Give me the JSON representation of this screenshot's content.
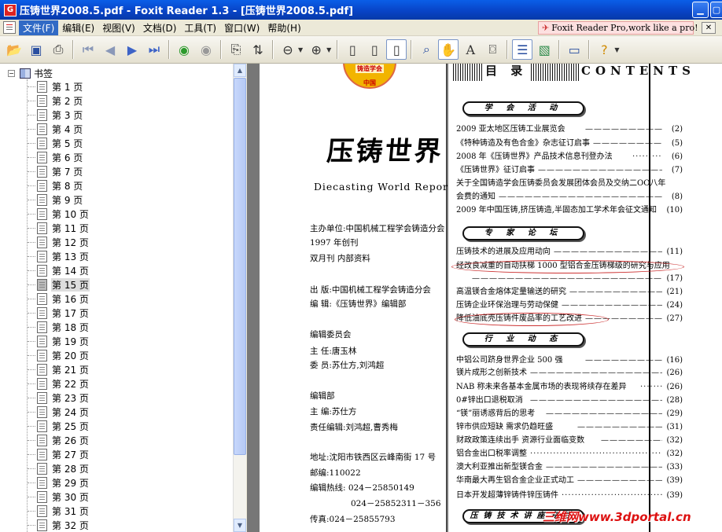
{
  "window": {
    "title": "压铸世界2008.5.pdf - Foxit Reader 1.3 - [压铸世界2008.5.pdf]",
    "app_icon": "G"
  },
  "menubar": {
    "items": [
      "文件(F)",
      "编辑(E)",
      "视图(V)",
      "文档(D)",
      "工具(T)",
      "窗口(W)",
      "帮助(H)"
    ],
    "promo": "Foxit Reader Pro,work like a pro!"
  },
  "toolbar": {
    "buttons": [
      "open-icon",
      "save-icon",
      "print-icon",
      "first-page-icon",
      "prev-page-icon",
      "next-page-icon",
      "last-page-icon",
      "back-icon",
      "forward-icon",
      "rotate-icon",
      "extract-icon",
      "zoom-out-icon",
      "zoom-in-icon",
      "single-page-icon",
      "continuous-icon",
      "facing-icon",
      "find-icon",
      "hand-tool-icon",
      "select-text-icon",
      "snapshot-icon",
      "bookmarks-icon",
      "thumbnails-icon",
      "annotation-icon",
      "help-icon"
    ]
  },
  "sidebar": {
    "root_label": "书签",
    "selected_index": 14,
    "pages": [
      "第 1 页",
      "第 2 页",
      "第 3 页",
      "第 4 页",
      "第 5 页",
      "第 6 页",
      "第 7 页",
      "第 8 页",
      "第 9 页",
      "第 10 页",
      "第 11 页",
      "第 12 页",
      "第 13 页",
      "第 14 页",
      "第 15 页",
      "第 16 页",
      "第 17 页",
      "第 18 页",
      "第 19 页",
      "第 20 页",
      "第 21 页",
      "第 22 页",
      "第 23 页",
      "第 24 页",
      "第 25 页",
      "第 26 页",
      "第 27 页",
      "第 28 页",
      "第 29 页",
      "第 30 页",
      "第 31 页",
      "第 32 页"
    ]
  },
  "left_page": {
    "logo_text_1": "铸造学会",
    "logo_text_2": "中国",
    "title": "压铸世界",
    "subtitle": "Diecasting World Report",
    "info_lines": [
      "主办单位:中国机械工程学会铸造分会",
      "1997 年创刊",
      "双月刊   内部资料",
      "出      版:中国机械工程学会铸造分会",
      "编      辑:《压铸世界》编辑部",
      "编辑委员会",
      "主   任:唐玉林",
      "委   员:苏仕方,刘鸿超",
      "编辑部",
      "主   编:苏仕方",
      "责任编辑:刘鸿超,曹秀梅",
      "地址:沈阳市铁西区云峰南街 17 号",
      "邮编:110022",
      "编辑热线:  024－25850149",
      "024－25852311－356",
      "传真:024－25855793"
    ]
  },
  "right_page": {
    "header_left": "目  录",
    "header_right": "CONTENTS",
    "sections": [
      "学 会 活 动",
      "专 家 论 坛",
      "行 业 动 态",
      "压铸技术讲座专栏"
    ],
    "entries": [
      {
        "text": "2009 亚太地区压铸工业展览会",
        "page": "(2)"
      },
      {
        "text": "《特种铸造及有色合金》杂志征订启事",
        "page": "(5)"
      },
      {
        "text": "2008 年《压铸世界》产品技术信息刊登办法",
        "page": "(6)"
      },
      {
        "text": "《压铸世界》征订启事",
        "page": "(7)"
      },
      {
        "text": "关于全国铸造学会压铸委员会发展团体会员及交纳二OO八年",
        "page": ""
      },
      {
        "text": "会费的通知",
        "page": "(8)"
      },
      {
        "text": "2009 年中国压铸,挤压铸造,半固态加工学术年会征文通知",
        "page": "(10)"
      },
      {
        "text": "压铸技术的进展及应用动向",
        "page": "(11)"
      },
      {
        "text": "经改良减重的自动扶梯 1000 型铝合金压铸梯级的研究与应用",
        "page": ""
      },
      {
        "text": "",
        "page": "(17)"
      },
      {
        "text": "高温镁合金熔体定量输送的研究",
        "page": "(21)"
      },
      {
        "text": "压铸企业环保治理与劳动保健",
        "page": "(24)"
      },
      {
        "text": "降低油底壳压铸件废品率的工艺改进",
        "page": "(27)"
      },
      {
        "text": "中铝公司跻身世界企业 500 强",
        "page": "(16)"
      },
      {
        "text": "镁片成形之创新技术",
        "page": "(26)"
      },
      {
        "text": "NAB 称未来各基本金属市场的表现将续存在差异",
        "page": "(26)"
      },
      {
        "text": "0#锌出口退税取消",
        "page": "(28)"
      },
      {
        "text": "“镁”丽诱惑背后的思考",
        "page": "(29)"
      },
      {
        "text": "锌市供应短缺   需求仍趋旺盛",
        "page": "(31)"
      },
      {
        "text": "财政政策连续出手  资源行业面临变数",
        "page": "(32)"
      },
      {
        "text": "铝合金出口税率调整",
        "page": "(32)"
      },
      {
        "text": "澳大利亚推出新型镁合金",
        "page": "(33)"
      },
      {
        "text": "华南最大再生铝合金企业正式动工",
        "page": "(39)"
      },
      {
        "text": "日本开发超薄锌铸件锌压铸件",
        "page": "(39)"
      }
    ],
    "watermark": "三维网www.3dportal.cn"
  }
}
